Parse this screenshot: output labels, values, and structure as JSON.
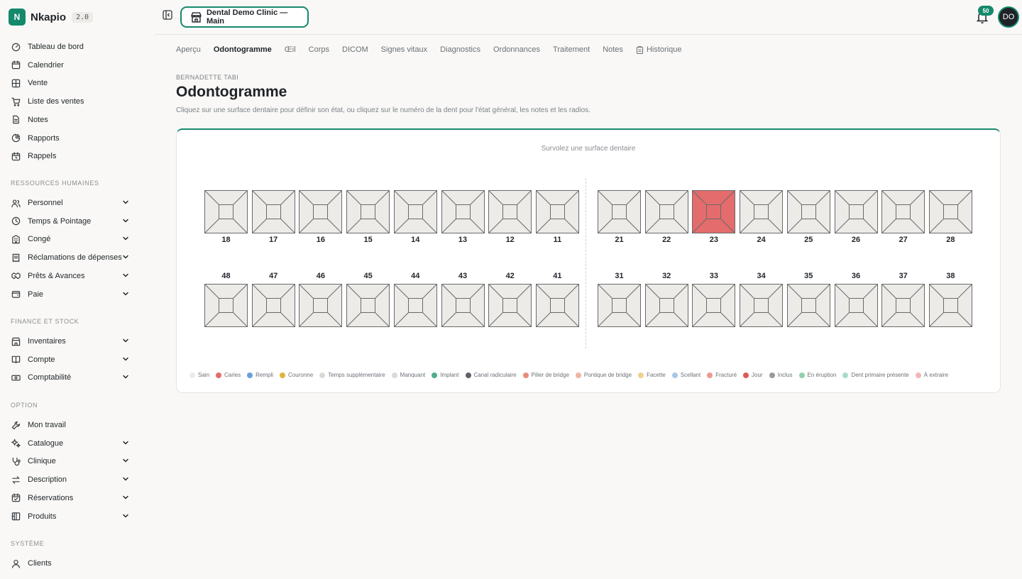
{
  "brand": {
    "logo": "N",
    "name": "Nkapio",
    "version": "2.0"
  },
  "sidebar": {
    "main_items": [
      {
        "label": "Tableau de bord",
        "icon": "gauge-icon"
      },
      {
        "label": "Calendrier",
        "icon": "calendar-icon"
      },
      {
        "label": "Vente",
        "icon": "grid-icon"
      },
      {
        "label": "Liste des ventes",
        "icon": "cart-icon"
      },
      {
        "label": "Notes",
        "icon": "document-icon"
      },
      {
        "label": "Rapports",
        "icon": "pie-chart-icon"
      },
      {
        "label": "Rappels",
        "icon": "calendar-clock-icon"
      }
    ],
    "sections": [
      {
        "title": "RESSOURCES HUMAINES",
        "items": [
          {
            "label": "Personnel",
            "icon": "users-icon"
          },
          {
            "label": "Temps & Pointage",
            "icon": "clock-icon"
          },
          {
            "label": "Congé",
            "icon": "building-icon"
          },
          {
            "label": "Réclamations de dépenses",
            "icon": "receipt-icon"
          },
          {
            "label": "Prêts & Avances",
            "icon": "handshake-icon"
          },
          {
            "label": "Paie",
            "icon": "wallet-icon"
          }
        ]
      },
      {
        "title": "FINANCE ET STOCK",
        "items": [
          {
            "label": "Inventaires",
            "icon": "store-icon"
          },
          {
            "label": "Compte",
            "icon": "book-icon"
          },
          {
            "label": "Comptabilité",
            "icon": "cash-icon"
          }
        ]
      },
      {
        "title": "OPTION",
        "items": [
          {
            "label": "Mon travail",
            "icon": "wrench-icon"
          },
          {
            "label": "Catalogue",
            "icon": "sparkles-icon"
          },
          {
            "label": "Clinique",
            "icon": "stethoscope-icon"
          },
          {
            "label": "Description",
            "icon": "arrows-icon"
          },
          {
            "label": "Réservations",
            "icon": "calendar-check-icon"
          },
          {
            "label": "Produits",
            "icon": "box-icon"
          }
        ]
      },
      {
        "title": "SYSTÈME",
        "items": [
          {
            "label": "Clients",
            "icon": "user-icon"
          }
        ]
      }
    ]
  },
  "header": {
    "clinic": "Dental Demo Clinic — Main",
    "notifications": "50",
    "avatar": "DO"
  },
  "tabs": [
    "Aperçu",
    "Odontogramme",
    "Œil",
    "Corps",
    "DICOM",
    "Signes vitaux",
    "Diagnostics",
    "Ordonnances",
    "Traitement",
    "Notes",
    "Historique"
  ],
  "active_tab": "Odontogramme",
  "patient_name": "BERNADETTE TABI",
  "page_title": "Odontogramme",
  "page_description": "Cliquez sur une surface dentaire pour définir son état, ou cliquez sur le numéro de la dent pour l'état général, les notes et les radios.",
  "hover_hint": "Survolez une surface dentaire",
  "teeth": {
    "upper_right": [
      "18",
      "17",
      "16",
      "15",
      "14",
      "13",
      "12",
      "11"
    ],
    "upper_left": [
      "21",
      "22",
      "23",
      "24",
      "25",
      "26",
      "27",
      "28"
    ],
    "lower_right": [
      "48",
      "47",
      "46",
      "45",
      "44",
      "43",
      "42",
      "41"
    ],
    "lower_left": [
      "31",
      "32",
      "33",
      "34",
      "35",
      "36",
      "37",
      "38"
    ],
    "status": {
      "23": "Caries"
    }
  },
  "legend": [
    {
      "label": "Sain",
      "color": "#ecebe8"
    },
    {
      "label": "Caries",
      "color": "#e46c6c"
    },
    {
      "label": "Rempli",
      "color": "#6b9fd6"
    },
    {
      "label": "Couronne",
      "color": "#e0b43c"
    },
    {
      "label": "Temps supplémentaire",
      "color": "#dcdad6"
    },
    {
      "label": "Manquant",
      "color": "#dcdad6"
    },
    {
      "label": "Implant",
      "color": "#4fae8e"
    },
    {
      "label": "Canal radiculaire",
      "color": "#5f6266"
    },
    {
      "label": "Pilier de bridge",
      "color": "#e68d78"
    },
    {
      "label": "Pontique de bridge",
      "color": "#f0b4a4"
    },
    {
      "label": "Facette",
      "color": "#f0d08c"
    },
    {
      "label": "Scellant",
      "color": "#a9c8e6"
    },
    {
      "label": "Fracturé",
      "color": "#e89a8e"
    },
    {
      "label": "Jour",
      "color": "#dc5a5a"
    },
    {
      "label": "Inclus",
      "color": "#9a9a9a"
    },
    {
      "label": "En éruption",
      "color": "#8fd1ad"
    },
    {
      "label": "Dent primaire présente",
      "color": "#a8dcc6"
    },
    {
      "label": "À extraire",
      "color": "#f2b8b8"
    }
  ],
  "colors": {
    "accent": "#15896b",
    "caries": "#e46c6c",
    "healthy": "#ecebe8"
  }
}
